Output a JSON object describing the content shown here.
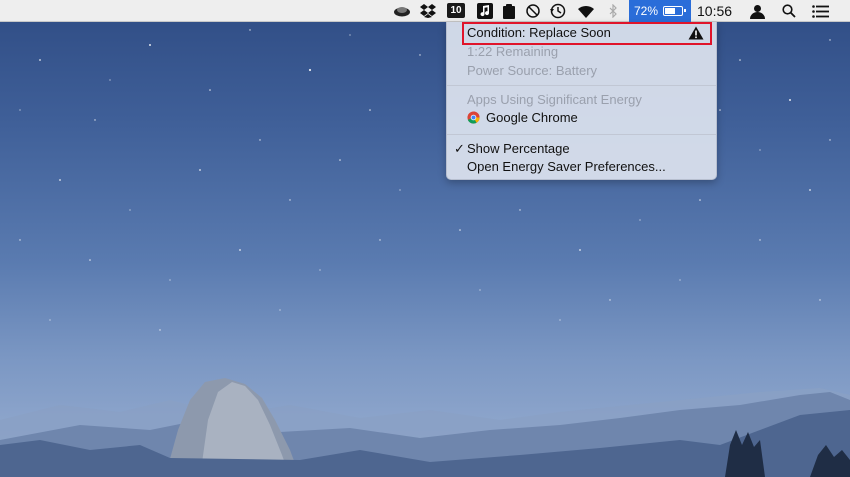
{
  "menubar": {
    "badge_number": "10",
    "battery_percent": "72%",
    "battery_level": 0.72,
    "clock": "10:56",
    "icons": [
      "cloud-icon",
      "dropbox-icon",
      "badge-10-icon",
      "music-icon",
      "clipboard-icon",
      "stop-icon",
      "time-machine-icon",
      "wifi-icon",
      "bluetooth-icon",
      "battery-icon",
      "user-icon",
      "spotlight-icon",
      "notification-center-icon"
    ],
    "accent_color": "#2a6dd9"
  },
  "battery_menu": {
    "condition": "Condition: Replace Soon",
    "remaining": "1:22 Remaining",
    "power_source": "Power Source: Battery",
    "apps_header": "Apps Using Significant Energy",
    "app_chrome": "Google Chrome",
    "show_percentage": "Show Percentage",
    "open_prefs": "Open Energy Saver Preferences...",
    "highlight_color": "#e0142a"
  }
}
